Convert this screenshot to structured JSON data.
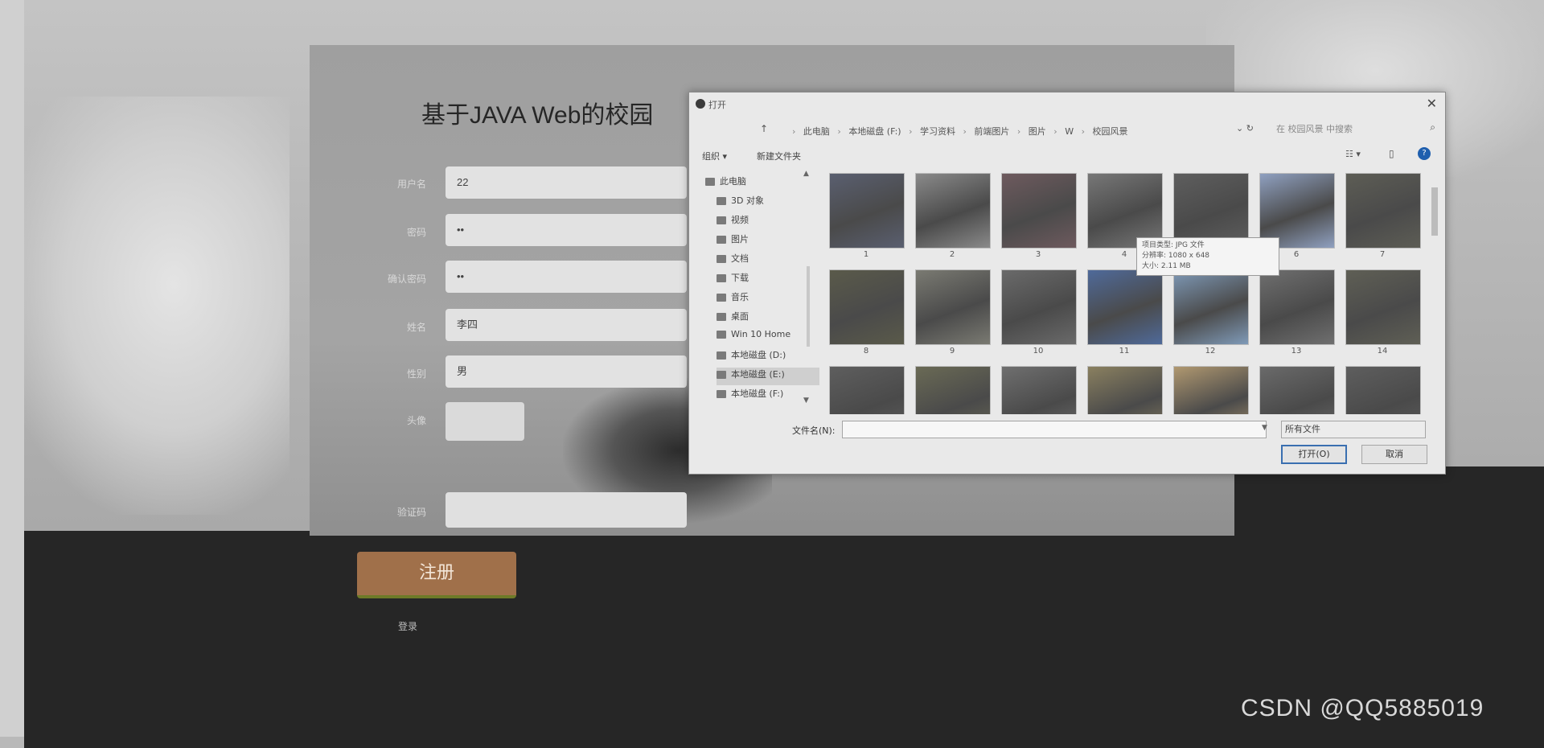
{
  "page": {
    "title": "基于JAVA Web的校园",
    "watermark": "CSDN @QQ5885019"
  },
  "form": {
    "fields": [
      {
        "label": "用户名",
        "value": "22"
      },
      {
        "label": "密码",
        "value": "••"
      },
      {
        "label": "确认密码",
        "value": "••"
      },
      {
        "label": "姓名",
        "value": "李四"
      },
      {
        "label": "性别",
        "value": "男"
      }
    ],
    "avatar_label": "头像",
    "code_label": "验证码",
    "code_placeholder": "",
    "register_label": "注册",
    "login_link": "登录",
    "footer_text": ""
  },
  "dialog": {
    "title": "打开",
    "close": "✕",
    "address": {
      "up": "↑",
      "crumbs": [
        "此电脑",
        "本地磁盘 (F:)",
        "学习资料",
        "前端图片",
        "图片",
        "W",
        "校园风景"
      ],
      "dropdown": "⌄",
      "refresh": "↻",
      "search_placeholder": "在 校园风景 中搜索"
    },
    "toolbar": {
      "organize": "组织 ▾",
      "new_folder": "新建文件夹",
      "view": "☷ ▾",
      "pane": "▯",
      "help": "?"
    },
    "nav": {
      "items": [
        {
          "label": "此电脑",
          "icon": "computer-icon"
        },
        {
          "label": "3D 对象",
          "icon": "3d-objects-icon"
        },
        {
          "label": "视频",
          "icon": "video-icon"
        },
        {
          "label": "图片",
          "icon": "pictures-icon"
        },
        {
          "label": "文档",
          "icon": "documents-icon"
        },
        {
          "label": "下载",
          "icon": "download-icon"
        },
        {
          "label": "音乐",
          "icon": "music-icon"
        },
        {
          "label": "桌面",
          "icon": "desktop-icon"
        },
        {
          "label": "Win 10 Home",
          "icon": "drive-icon"
        },
        {
          "label": "本地磁盘 (D:)",
          "icon": "drive-icon"
        },
        {
          "label": "本地磁盘 (E:)",
          "icon": "drive-icon"
        },
        {
          "label": "本地磁盘 (F:)",
          "icon": "drive-icon"
        }
      ],
      "selected_index": 10
    },
    "files": [
      {
        "name": "1",
        "color": "#5a5f70"
      },
      {
        "name": "2",
        "color": "#8a8a8a"
      },
      {
        "name": "3",
        "color": "#6e5a5e"
      },
      {
        "name": "4",
        "color": "#777777"
      },
      {
        "name": "5",
        "color": "#5e5e5e"
      },
      {
        "name": "6",
        "color": "#8fa0c0"
      },
      {
        "name": "7",
        "color": "#5d5d55"
      },
      {
        "name": "8",
        "color": "#5a5a4a"
      },
      {
        "name": "9",
        "color": "#7a7a72"
      },
      {
        "name": "10",
        "color": "#6a6a6a"
      },
      {
        "name": "11",
        "color": "#4f6a9a"
      },
      {
        "name": "12",
        "color": "#7f9ab8"
      },
      {
        "name": "13",
        "color": "#6f6f6f"
      },
      {
        "name": "14",
        "color": "#5f5f55"
      },
      {
        "name": "",
        "color": "#5e5e5e"
      },
      {
        "name": "",
        "color": "#6a6a55"
      },
      {
        "name": "",
        "color": "#6f6f6f"
      },
      {
        "name": "",
        "color": "#8a8060"
      },
      {
        "name": "",
        "color": "#b09870"
      },
      {
        "name": "",
        "color": "#6a6a6a"
      },
      {
        "name": "",
        "color": "#5e5e5e"
      }
    ],
    "tooltip": {
      "line1": "项目类型: JPG 文件",
      "line2": "分辨率: 1080 x 648",
      "line3": "大小: 2.11 MB"
    },
    "filename_label": "文件名(N):",
    "filename_value": "",
    "filter_label": "所有文件",
    "open_label": "打开(O)",
    "cancel_label": "取消"
  }
}
